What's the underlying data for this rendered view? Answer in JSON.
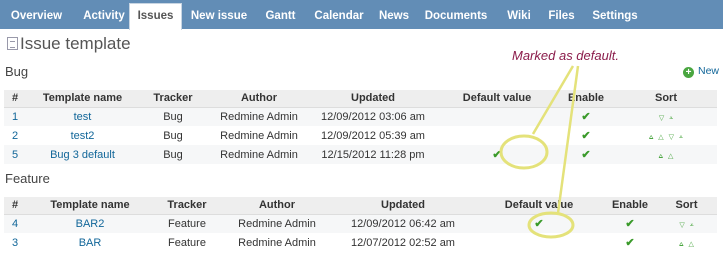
{
  "menu": {
    "tabs": [
      {
        "label": "Overview"
      },
      {
        "label": "Activity"
      },
      {
        "label": "Issues",
        "selected": true
      },
      {
        "label": "New issue"
      },
      {
        "label": "Gantt"
      },
      {
        "label": "Calendar"
      },
      {
        "label": "News"
      },
      {
        "label": "Documents"
      },
      {
        "label": "Wiki"
      },
      {
        "label": "Files"
      },
      {
        "label": "Settings"
      }
    ]
  },
  "page": {
    "title": "Issue template",
    "new_label": "New",
    "annotation": "Marked as default."
  },
  "bug": {
    "section_title": "Bug",
    "columns": [
      "#",
      "Template name",
      "Tracker",
      "Author",
      "Updated",
      "Default value",
      "Enable",
      "Sort"
    ],
    "rows": [
      {
        "id": "1",
        "name": "test",
        "tracker": "Bug",
        "author": "Redmine Admin",
        "updated": "12/09/2012 03:06 am",
        "default": false,
        "enable": true,
        "sort": [
          "down",
          "bottom"
        ]
      },
      {
        "id": "2",
        "name": "test2",
        "tracker": "Bug",
        "author": "Redmine Admin",
        "updated": "12/09/2012 05:39 am",
        "default": false,
        "enable": true,
        "sort": [
          "top",
          "up",
          "down",
          "bottom"
        ]
      },
      {
        "id": "5",
        "name": "Bug 3 default",
        "tracker": "Bug",
        "author": "Redmine Admin",
        "updated": "12/15/2012 11:28 pm",
        "default": true,
        "enable": true,
        "sort": [
          "top",
          "up"
        ]
      }
    ]
  },
  "feature": {
    "section_title": "Feature",
    "columns": [
      "#",
      "Template name",
      "Tracker",
      "Author",
      "Updated",
      "Default value",
      "Enable",
      "Sort"
    ],
    "rows": [
      {
        "id": "4",
        "name": "BAR2",
        "tracker": "Feature",
        "author": "Redmine Admin",
        "updated": "12/09/2012 06:42 am",
        "default": true,
        "enable": true,
        "sort": [
          "down",
          "bottom"
        ]
      },
      {
        "id": "3",
        "name": "BAR",
        "tracker": "Feature",
        "author": "Redmine Admin",
        "updated": "12/07/2012 02:52 am",
        "default": false,
        "enable": true,
        "sort": [
          "top",
          "up"
        ]
      }
    ]
  },
  "colors": {
    "menu_bg": "#628db6",
    "link": "#169",
    "check": "#3a9a2a",
    "annotation_text": "#8b1c4b",
    "annotation_stroke": "#e4e27a"
  }
}
